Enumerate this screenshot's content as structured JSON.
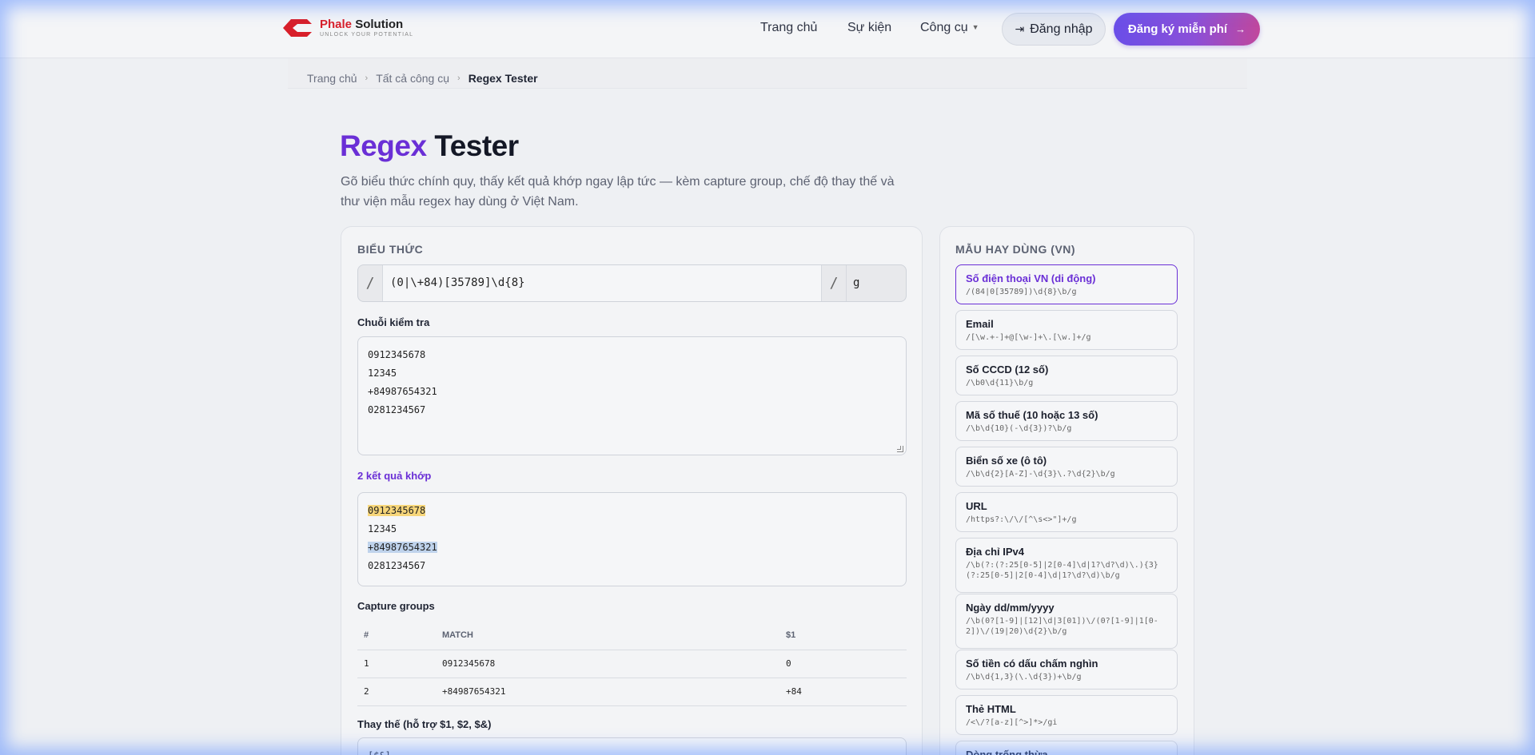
{
  "brand": {
    "name_red": "Phale",
    "name_rest": " Solution",
    "tagline": "UNLOCK YOUR POTENTIAL"
  },
  "nav": {
    "home": "Trang chủ",
    "events": "Sự kiện",
    "tools": "Công cụ",
    "login": "Đăng nhập",
    "signup": "Đăng ký miễn phí"
  },
  "breadcrumb": {
    "home": "Trang chủ",
    "all_tools": "Tất cả công cụ",
    "current": "Regex Tester"
  },
  "page": {
    "title_accent": "Regex",
    "title_rest": "Tester",
    "subtitle": "Gõ biểu thức chính quy, thấy kết quả khớp ngay lập tức — kèm capture group, chế độ thay thế và thư viện mẫu regex hay dùng ở Việt Nam."
  },
  "expression": {
    "label": "BIỂU THỨC",
    "slash": "/",
    "pattern": "(0|\\+84)[35789]\\d{8}",
    "flags": "g"
  },
  "test_string": {
    "label": "Chuỗi kiểm tra",
    "lines": [
      "0912345678",
      "12345",
      "+84987654321",
      "0281234567"
    ]
  },
  "results": {
    "count_label": "2 kết quả khớp",
    "lines": [
      "0912345678",
      "12345",
      "+84987654321",
      "0281234567"
    ]
  },
  "capture": {
    "label": "Capture groups",
    "headers": [
      "#",
      "MATCH",
      "$1"
    ],
    "rows": [
      [
        "1",
        "0912345678",
        "0"
      ],
      [
        "2",
        "+84987654321",
        "+84"
      ]
    ]
  },
  "replace": {
    "label": "Thay thế (hỗ trợ $1, $2, $&)",
    "value": "[$&]"
  },
  "patterns": {
    "label": "MẪU HAY DÙNG (VN)",
    "items": [
      {
        "name": "Số điện thoại VN (di động)",
        "regex": "/(84|0[35789])\\d{8}\\b/g"
      },
      {
        "name": "Email",
        "regex": "/[\\w.+-]+@[\\w-]+\\.[\\w.]+/g"
      },
      {
        "name": "Số CCCD (12 số)",
        "regex": "/\\b0\\d{11}\\b/g"
      },
      {
        "name": "Mã số thuế (10 hoặc 13 số)",
        "regex": "/\\b\\d{10}(-\\d{3})?\\b/g"
      },
      {
        "name": "Biển số xe (ô tô)",
        "regex": "/\\b\\d{2}[A-Z]-\\d{3}\\.?\\d{2}\\b/g"
      },
      {
        "name": "URL",
        "regex": "/https?:\\/\\/[^\\s<>\"]+/g"
      },
      {
        "name": "Địa chỉ IPv4",
        "regex": "/\\b(?:(?:25[0-5]|2[0-4]\\d|1?\\d?\\d)\\.){3}(?:25[0-5]|2[0-4]\\d|1?\\d?\\d)\\b/g"
      },
      {
        "name": "Ngày dd/mm/yyyy",
        "regex": "/\\b(0?[1-9]|[12]\\d|3[01])\\/(0?[1-9]|1[0-2])\\/(19|20)\\d{2}\\b/g"
      },
      {
        "name": "Số tiền có dấu chấm nghìn",
        "regex": "/\\b\\d{1,3}(\\.\\d{3})+\\b/g"
      },
      {
        "name": "Thẻ HTML",
        "regex": "/<\\/?[a-z][^>]*>/gi"
      },
      {
        "name": "Dòng trống thừa",
        "regex": ""
      }
    ]
  },
  "colors": {
    "accent": "#6a2fd6",
    "match_highlight_1": "#f7d67a",
    "match_highlight_2": "#bfd3ec",
    "brand_red": "#d81f2a"
  }
}
